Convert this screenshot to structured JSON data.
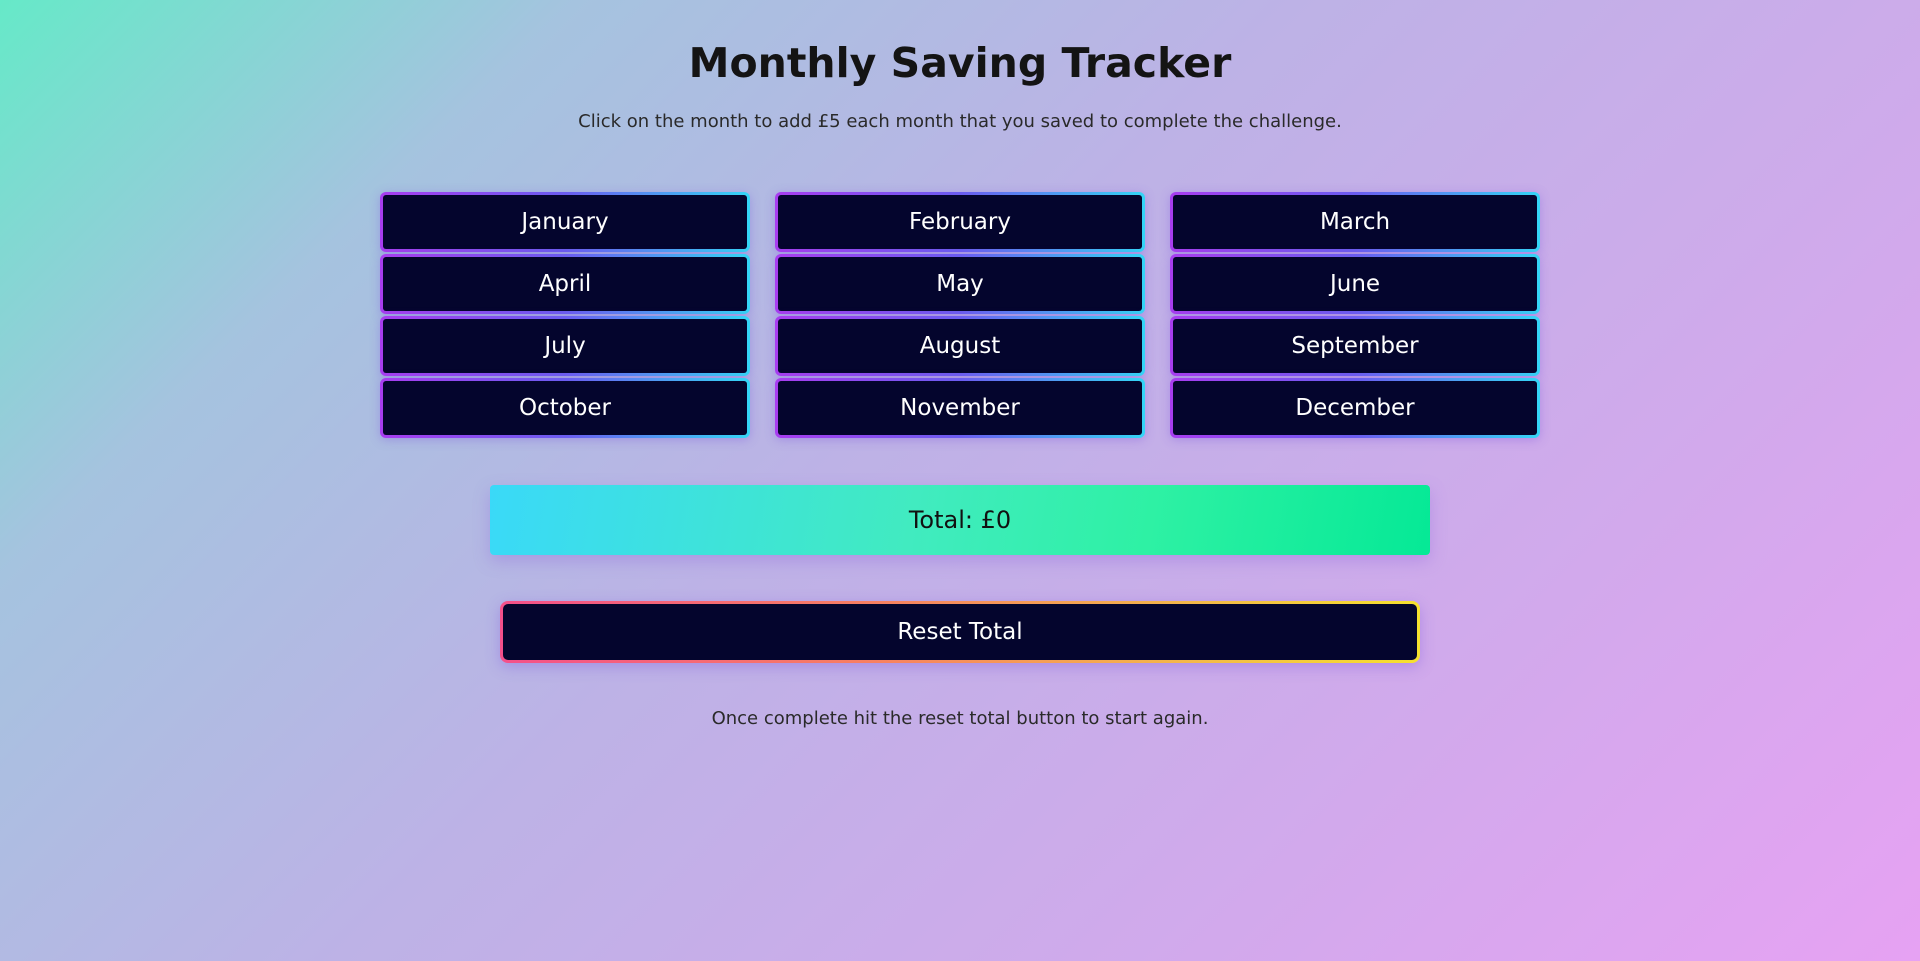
{
  "header": {
    "title": "Monthly Saving Tracker",
    "subtitle": "Click on the month to add £5 each month that you saved to complete the challenge."
  },
  "months": [
    {
      "label": "January"
    },
    {
      "label": "February"
    },
    {
      "label": "March"
    },
    {
      "label": "April"
    },
    {
      "label": "May"
    },
    {
      "label": "June"
    },
    {
      "label": "July"
    },
    {
      "label": "August"
    },
    {
      "label": "September"
    },
    {
      "label": "October"
    },
    {
      "label": "November"
    },
    {
      "label": "December"
    }
  ],
  "total": {
    "label": "Total: £0"
  },
  "reset": {
    "label": "Reset Total"
  },
  "footer": {
    "note": "Once complete hit the reset total button to start again."
  },
  "colors": {
    "button_bg": "#04052d",
    "month_border_start": "#a83df0",
    "month_border_end": "#34d6f6",
    "reset_border_start": "#f4508a",
    "reset_border_end": "#f6e12e",
    "total_gradient_start": "#3ad9f8",
    "total_gradient_end": "#05e996"
  }
}
